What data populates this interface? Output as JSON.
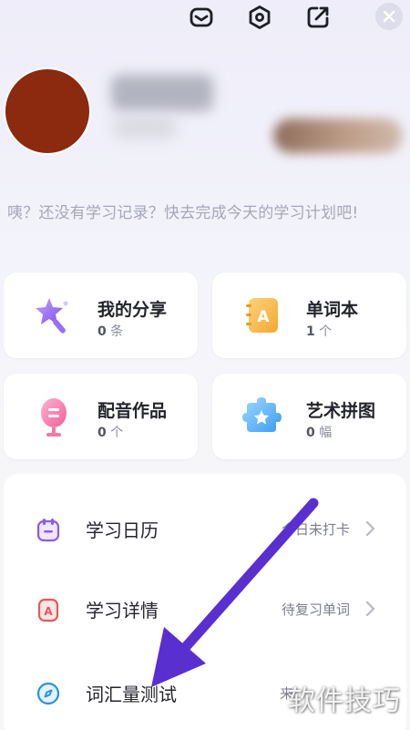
{
  "header": {
    "icons": [
      "mail-icon",
      "settings-icon",
      "share-icon",
      "close-icon"
    ]
  },
  "profile": {
    "tip": "咦？还没有学习记录？快去完成今天的学习计划吧!"
  },
  "cards": [
    {
      "title": "我的分享",
      "count": "0",
      "unit": "条",
      "icon": "star-wand-icon"
    },
    {
      "title": "单词本",
      "count": "1",
      "unit": "个",
      "icon": "wordbook-icon"
    },
    {
      "title": "配音作品",
      "count": "0",
      "unit": "个",
      "icon": "microphone-icon"
    },
    {
      "title": "艺术拼图",
      "count": "0",
      "unit": "幅",
      "icon": "puzzle-icon"
    }
  ],
  "list": [
    {
      "label": "学习日历",
      "status": "今日未打卡",
      "icon": "calendar-icon"
    },
    {
      "label": "学习详情",
      "status": "待复习单词",
      "icon": "details-icon"
    },
    {
      "label": "词汇量测试",
      "status": "来",
      "icon": "compass-icon"
    }
  ],
  "colors": {
    "accent_purple": "#6b3fd6",
    "arrow": "#5a2fcf",
    "avatar": "#8b2a0e"
  },
  "watermark": "软件技巧"
}
